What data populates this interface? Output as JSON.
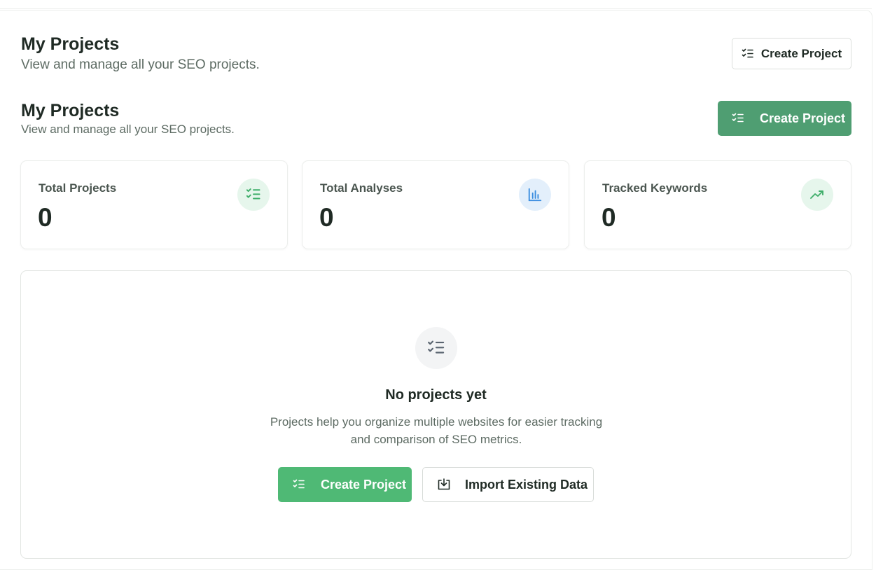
{
  "header": {
    "title": "My Projects",
    "subtitle": "View and manage all your SEO projects.",
    "create_label": "Create Project"
  },
  "section": {
    "title": "My Projects",
    "subtitle": "View and manage all your SEO projects.",
    "create_label": "Create Project"
  },
  "stats": [
    {
      "label": "Total Projects",
      "value": "0",
      "icon": "list-check-icon",
      "color": "#3fae6a",
      "bg": "#e6f6ec"
    },
    {
      "label": "Total Analyses",
      "value": "0",
      "icon": "bar-chart-icon",
      "color": "#3a8de0",
      "bg": "#e3effb"
    },
    {
      "label": "Tracked Keywords",
      "value": "0",
      "icon": "trending-up-icon",
      "color": "#3fae6a",
      "bg": "#e6f6ec"
    }
  ],
  "empty_state": {
    "title": "No projects yet",
    "description_line1": "Projects help you organize multiple websites for easier tracking",
    "description_line2": "and comparison of SEO metrics.",
    "create_label": "Create Project",
    "import_label": "Import Existing Data"
  },
  "colors": {
    "primary_green": "#4fb975",
    "dark_green": "#4f9e72",
    "text_dark": "#1f2a24",
    "text_muted": "#5d6b63"
  }
}
